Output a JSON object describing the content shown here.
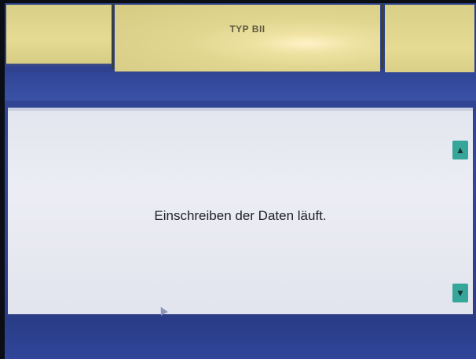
{
  "header": {
    "tabs": [
      {
        "label": ""
      },
      {
        "label": "TYP BII"
      },
      {
        "label": ""
      }
    ]
  },
  "dialog": {
    "message": "Einschreiben der Daten läuft."
  },
  "scroll": {
    "up_icon": "up-arrow-icon",
    "down_icon": "down-arrow-icon"
  },
  "colors": {
    "tab_background": "#e0d690",
    "frame_blue": "#33479a",
    "panel_background": "#e8e9f1",
    "scroll_button": "#36a69a"
  }
}
